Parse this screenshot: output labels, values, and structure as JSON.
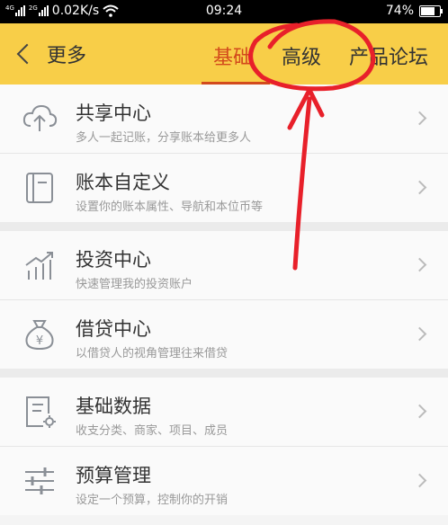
{
  "status_bar": {
    "speed": "0.02K/s",
    "time": "09:24",
    "battery": "74%",
    "battery_level": 0.74
  },
  "header": {
    "back_label": "更多",
    "tabs": [
      {
        "label": "基础"
      },
      {
        "label": "高级"
      },
      {
        "label": "产品论坛"
      }
    ]
  },
  "items": [
    {
      "title": "共享中心",
      "subtitle": "多人一起记账，分享账本给更多人",
      "icon": "cloud-share-icon"
    },
    {
      "title": "账本自定义",
      "subtitle": "设置你的账本属性、导航和本位币等",
      "icon": "book-icon"
    },
    {
      "title": "投资中心",
      "subtitle": "快速管理我的投资账户",
      "icon": "chart-icon"
    },
    {
      "title": "借贷中心",
      "subtitle": "以借贷人的视角管理往来借贷",
      "icon": "money-bag-icon"
    },
    {
      "title": "基础数据",
      "subtitle": "收支分类、商家、项目、成员",
      "icon": "data-settings-icon"
    },
    {
      "title": "预算管理",
      "subtitle": "设定一个预算，控制你的开销",
      "icon": "sliders-icon"
    }
  ],
  "colors": {
    "header": "#f8ce48",
    "accent": "#d24a1c",
    "annotation": "#e8202a"
  }
}
